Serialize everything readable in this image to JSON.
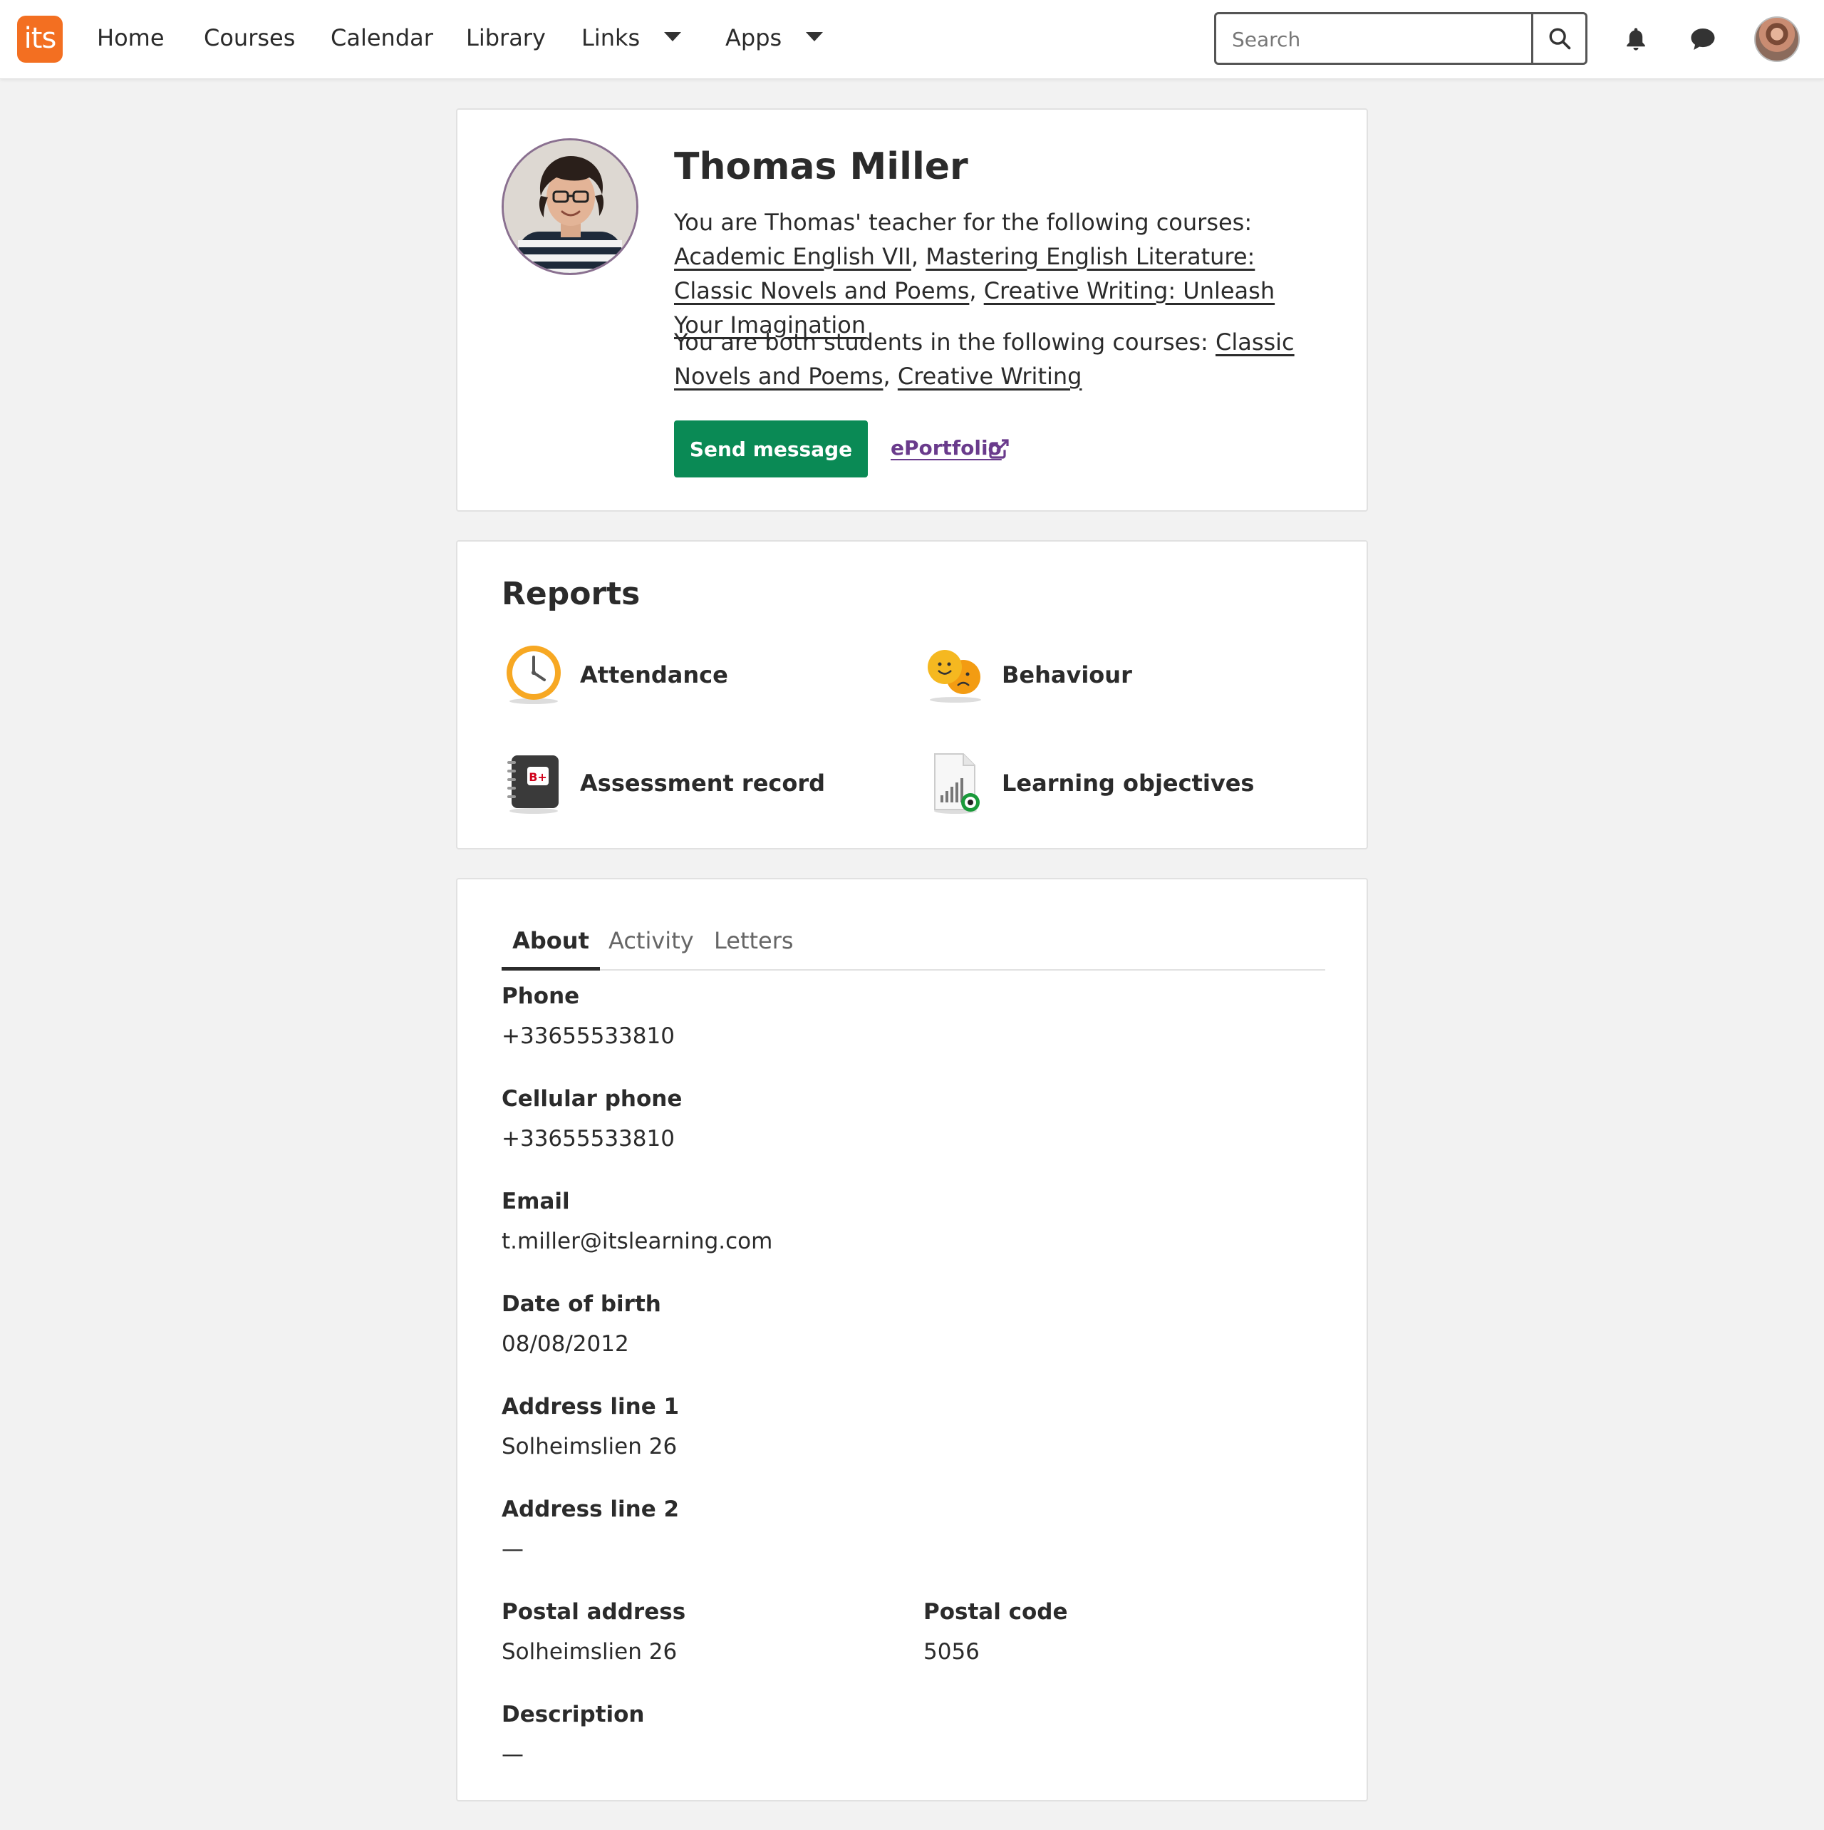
{
  "nav": {
    "logo": "its",
    "items": [
      "Home",
      "Courses",
      "Calendar",
      "Library"
    ],
    "links_label": "Links",
    "apps_label": "Apps",
    "search_placeholder": "Search"
  },
  "profile": {
    "name": "Thomas Miller",
    "teacher_intro": "You are Thomas' teacher for the following courses: ",
    "teacher_courses": [
      "Academic English VII",
      "Mastering English Literature: Classic Novels and Poems",
      "Creative Writing: Unleash Your Imagination"
    ],
    "student_intro": "You are both students in the following courses: ",
    "student_courses": [
      "Classic Novels and Poems",
      "Creative Writing"
    ],
    "separator": ", ",
    "send_message": "Send message",
    "eportfolio": "ePortfolio"
  },
  "reports": {
    "title": "Reports",
    "items": [
      {
        "label": "Attendance",
        "icon": "clock-icon"
      },
      {
        "label": "Behaviour",
        "icon": "smiley-faces-icon"
      },
      {
        "label": "Assessment record",
        "icon": "gradebook-icon"
      },
      {
        "label": "Learning objectives",
        "icon": "objectives-chart-icon"
      }
    ]
  },
  "tabs": [
    "About",
    "Activity",
    "Letters"
  ],
  "about": {
    "phone_label": "Phone",
    "phone": "+33655533810",
    "cell_label": "Cellular phone",
    "cell": "+33655533810",
    "email_label": "Email",
    "email": "t.miller@itslearning.com",
    "dob_label": "Date of birth",
    "dob": "08/08/2012",
    "addr1_label": "Address line 1",
    "addr1": "Solheimslien 26",
    "addr2_label": "Address line 2",
    "addr2": "—",
    "postal_address_label": "Postal address",
    "postal_address": "Solheimslien 26",
    "postal_code_label": "Postal code",
    "postal_code": "5056",
    "description_label": "Description",
    "description": "—"
  },
  "colors": {
    "brand": "#f36f21",
    "primary_button": "#0a8a55",
    "link_purple": "#6a3b8c",
    "background": "#f2f2f2"
  }
}
